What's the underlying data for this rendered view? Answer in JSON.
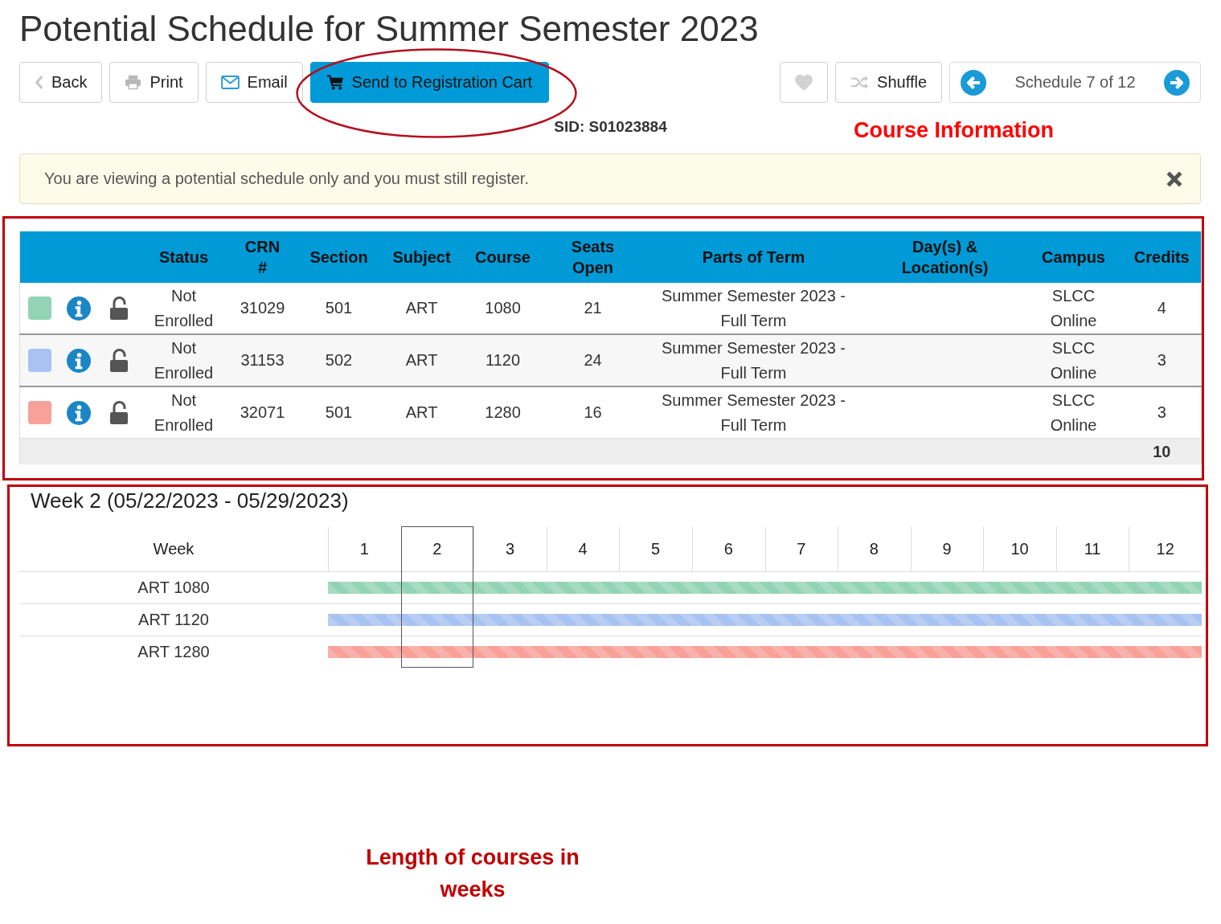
{
  "page": {
    "title": "Potential Schedule for Summer Semester 2023"
  },
  "toolbar": {
    "left_buttons": [
      {
        "kind": "back",
        "label": "Back"
      },
      {
        "kind": "print",
        "label": "Print"
      },
      {
        "kind": "email",
        "label": "Email"
      },
      {
        "kind": "cart",
        "label": "Send to Registration Cart"
      }
    ],
    "right_buttons": [
      {
        "kind": "favorite"
      },
      {
        "kind": "shuffle",
        "label": "Shuffle"
      }
    ],
    "schedule_nav": {
      "label": "Schedule 7 of 12"
    }
  },
  "student_id": "SID: S01023884",
  "alert": {
    "message": "You are viewing a potential schedule only and you must still register."
  },
  "course_table": {
    "columns": [
      "Status",
      "CRN #",
      "Section",
      "Subject",
      "Course",
      "Seats Open",
      "Parts of Term",
      "Day(s) & Location(s)",
      "Campus",
      "Credits"
    ],
    "rows": [
      {
        "color": "#93d4b4",
        "status": "Not Enrolled",
        "crn": "31029",
        "section": "501",
        "subject": "ART",
        "course": "1080",
        "seats_open": "21",
        "parts_of_term": "Summer Semester 2023 - Full Term",
        "campus": "SLCC Online",
        "credits": "4"
      },
      {
        "color": "#a8c2f2",
        "status": "Not Enrolled",
        "crn": "31153",
        "section": "502",
        "subject": "ART",
        "course": "1120",
        "seats_open": "24",
        "parts_of_term": "Summer Semester 2023 - Full Term",
        "campus": "SLCC Online",
        "credits": "3"
      },
      {
        "color": "#f7a198",
        "status": "Not Enrolled",
        "crn": "32071",
        "section": "501",
        "subject": "ART",
        "course": "1280",
        "seats_open": "16",
        "parts_of_term": "Summer Semester 2023 - Full Term",
        "campus": "SLCC Online",
        "credits": "3"
      }
    ],
    "total_credits": "10"
  },
  "week_view": {
    "title": "Week 2 (05/22/2023 - 05/29/2023)",
    "label_header": "Week",
    "weeks": [
      {
        "label": "1",
        "selected": false
      },
      {
        "label": "2",
        "selected": true
      },
      {
        "label": "3",
        "selected": false
      },
      {
        "label": "4",
        "selected": false
      },
      {
        "label": "5",
        "selected": false
      },
      {
        "label": "6",
        "selected": false
      },
      {
        "label": "7",
        "selected": false
      },
      {
        "label": "8",
        "selected": false
      },
      {
        "label": "9",
        "selected": false
      },
      {
        "label": "10",
        "selected": false
      },
      {
        "label": "11",
        "selected": false
      },
      {
        "label": "12",
        "selected": false
      }
    ],
    "courses": [
      {
        "label": "ART 1080",
        "color": "#93d4b4",
        "level": 1
      },
      {
        "label": "ART 1120",
        "color": "#a8c2f2",
        "level": 1
      },
      {
        "label": "ART 1280",
        "color": "#f7a198",
        "level": 1
      }
    ]
  },
  "annotations": {
    "course_information": "Course Information",
    "week_length_note": "Length of courses in weeks"
  }
}
